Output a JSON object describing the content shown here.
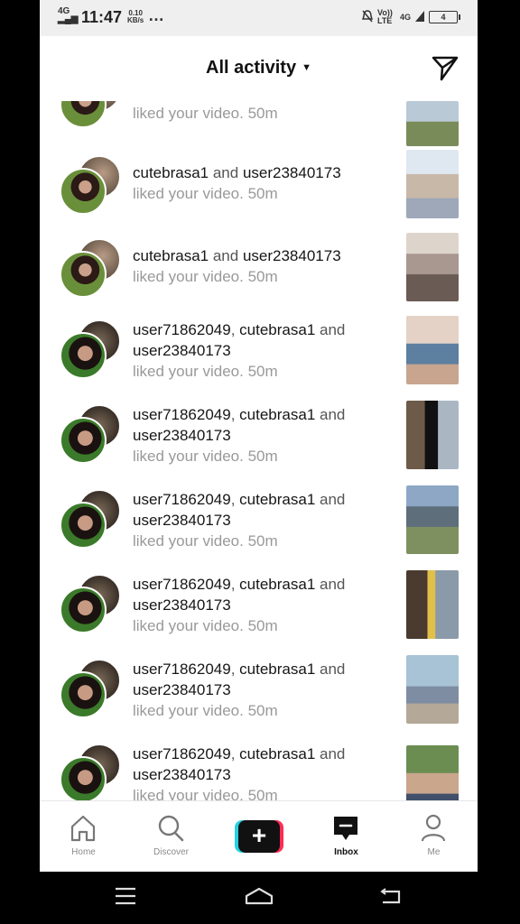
{
  "status_bar": {
    "network": "4G",
    "time": "11:47",
    "speed_value": "0.10",
    "speed_unit": "KB/s",
    "more": "…",
    "carrier": "Vo)) LTE",
    "signal_label": "4G",
    "battery": "4"
  },
  "header": {
    "title": "All activity",
    "dropdown_icon": "caret-down-icon",
    "send_icon": "paper-plane-icon"
  },
  "notifications": [
    {
      "partial": true,
      "users": [],
      "connector": [],
      "action": "liked your video.",
      "time": "50m"
    },
    {
      "users": [
        "cutebrasa1",
        "user23840173"
      ],
      "line1": [
        "cutebrasa1",
        " and ",
        "user23840173"
      ],
      "line2": "",
      "action": "liked your video.",
      "time": "50m"
    },
    {
      "users": [
        "cutebrasa1",
        "user23840173"
      ],
      "line1": [
        "cutebrasa1",
        " and ",
        "user23840173"
      ],
      "line2": "",
      "action": "liked your video.",
      "time": "50m"
    },
    {
      "line1": [
        "user71862049",
        ", ",
        "cutebrasa1",
        " and"
      ],
      "line2": "user23840173",
      "action": "liked your video.",
      "time": "50m"
    },
    {
      "line1": [
        "user71862049",
        ", ",
        "cutebrasa1",
        " and"
      ],
      "line2": "user23840173",
      "action": "liked your video.",
      "time": "50m"
    },
    {
      "line1": [
        "user71862049",
        ", ",
        "cutebrasa1",
        " and"
      ],
      "line2": "user23840173",
      "action": "liked your video.",
      "time": "50m"
    },
    {
      "line1": [
        "user71862049",
        ", ",
        "cutebrasa1",
        " and"
      ],
      "line2": "user23840173",
      "action": "liked your video.",
      "time": "50m"
    },
    {
      "line1": [
        "user71862049",
        ", ",
        "cutebrasa1",
        " and"
      ],
      "line2": "user23840173",
      "action": "liked your video.",
      "time": "50m"
    },
    {
      "line1": [
        "user71862049",
        ", ",
        "cutebrasa1",
        " and"
      ],
      "line2": "user23840173",
      "action": "liked your video.",
      "time": "50m"
    }
  ],
  "bottom_nav": [
    {
      "label": "Home",
      "icon": "home-icon",
      "active": false
    },
    {
      "label": "Discover",
      "icon": "search-icon",
      "active": false
    },
    {
      "label": "",
      "icon": "plus-icon",
      "active": false
    },
    {
      "label": "Inbox",
      "icon": "inbox-icon",
      "active": true
    },
    {
      "label": "Me",
      "icon": "profile-icon",
      "active": false
    }
  ],
  "plus_symbol": "+",
  "system_nav": {
    "menu_icon": "menu-icon",
    "home_icon": "home-outline-icon",
    "back_icon": "back-icon"
  }
}
